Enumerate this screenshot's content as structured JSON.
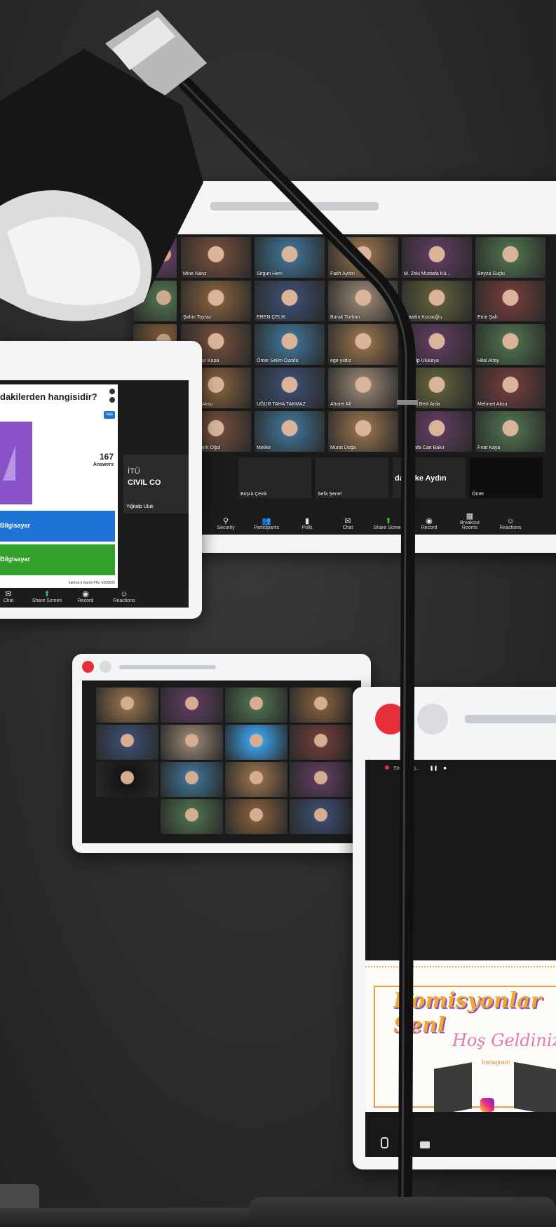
{
  "colors": {
    "close_dot": "#e8303a",
    "kahoot_purple": "#8a52c9",
    "kahoot_blue": "#1f74d6",
    "kahoot_green": "#33a02c",
    "background": "#2b2b2b"
  },
  "meeting": {
    "participants": [
      "Mine Nanz",
      "Sirgun Hem",
      "Fatih Aydın",
      "M. Zeki Mustafa Kü...",
      "Beyza Suçlu",
      "Şahin Toyraz",
      "EREN ÇELİK",
      "Burak Turhan",
      "Alaattin Kocaoğlu",
      "Emir Şah",
      "Hatice Nur Kapa",
      "Ömer Selim Özodu",
      "ege yıldız",
      "Yiğitalp Ulukaya",
      "Hilal Altay",
      "Mehmet Aksu",
      "UĞUR TAHA TAKMAZ",
      "Ahmet Ali",
      "Fettah Betil Arda",
      "Mehmet Aksu",
      "Ozcan Berk Oğul",
      "Melike",
      "Murat Doğa",
      "Mustafa Can Bakır",
      "Fırat Kaya"
    ],
    "bottom_row": [
      "Büşra Çevik",
      "Sefa Şenel",
      "dan İlke Aydın",
      "Ömer"
    ],
    "toolbar": [
      "Security",
      "Participants",
      "Polls",
      "Chat",
      "Share Screen",
      "Record",
      "Breakout Rooms",
      "Reactions"
    ],
    "participants_count": "28"
  },
  "quiz": {
    "question_fragment": "dakilerden hangisidir?",
    "answers_count": "167",
    "answers_label": "Answers",
    "skip_label": "Skip",
    "options": [
      "Bilgisayar",
      "Bilgisayar"
    ],
    "footer": "kahoot.it  Game PIN: 6250505",
    "side_name": "Yiğitalp Uluk",
    "side_logo_top": "İTÜ",
    "side_logo": "CIVIL CO",
    "toolbar": [
      "Chat",
      "Share Screen",
      "Record",
      "Reactions"
    ]
  },
  "small_meeting": {
    "tiles": 15
  },
  "stream": {
    "status": "Streaming...",
    "banner_title": "Komisyonlar Senl",
    "banner_welcome": "Hoş Geldiniz",
    "banner_sub": "İnstagram",
    "bottom_icons": [
      "mic-icon",
      "video-icon"
    ]
  }
}
